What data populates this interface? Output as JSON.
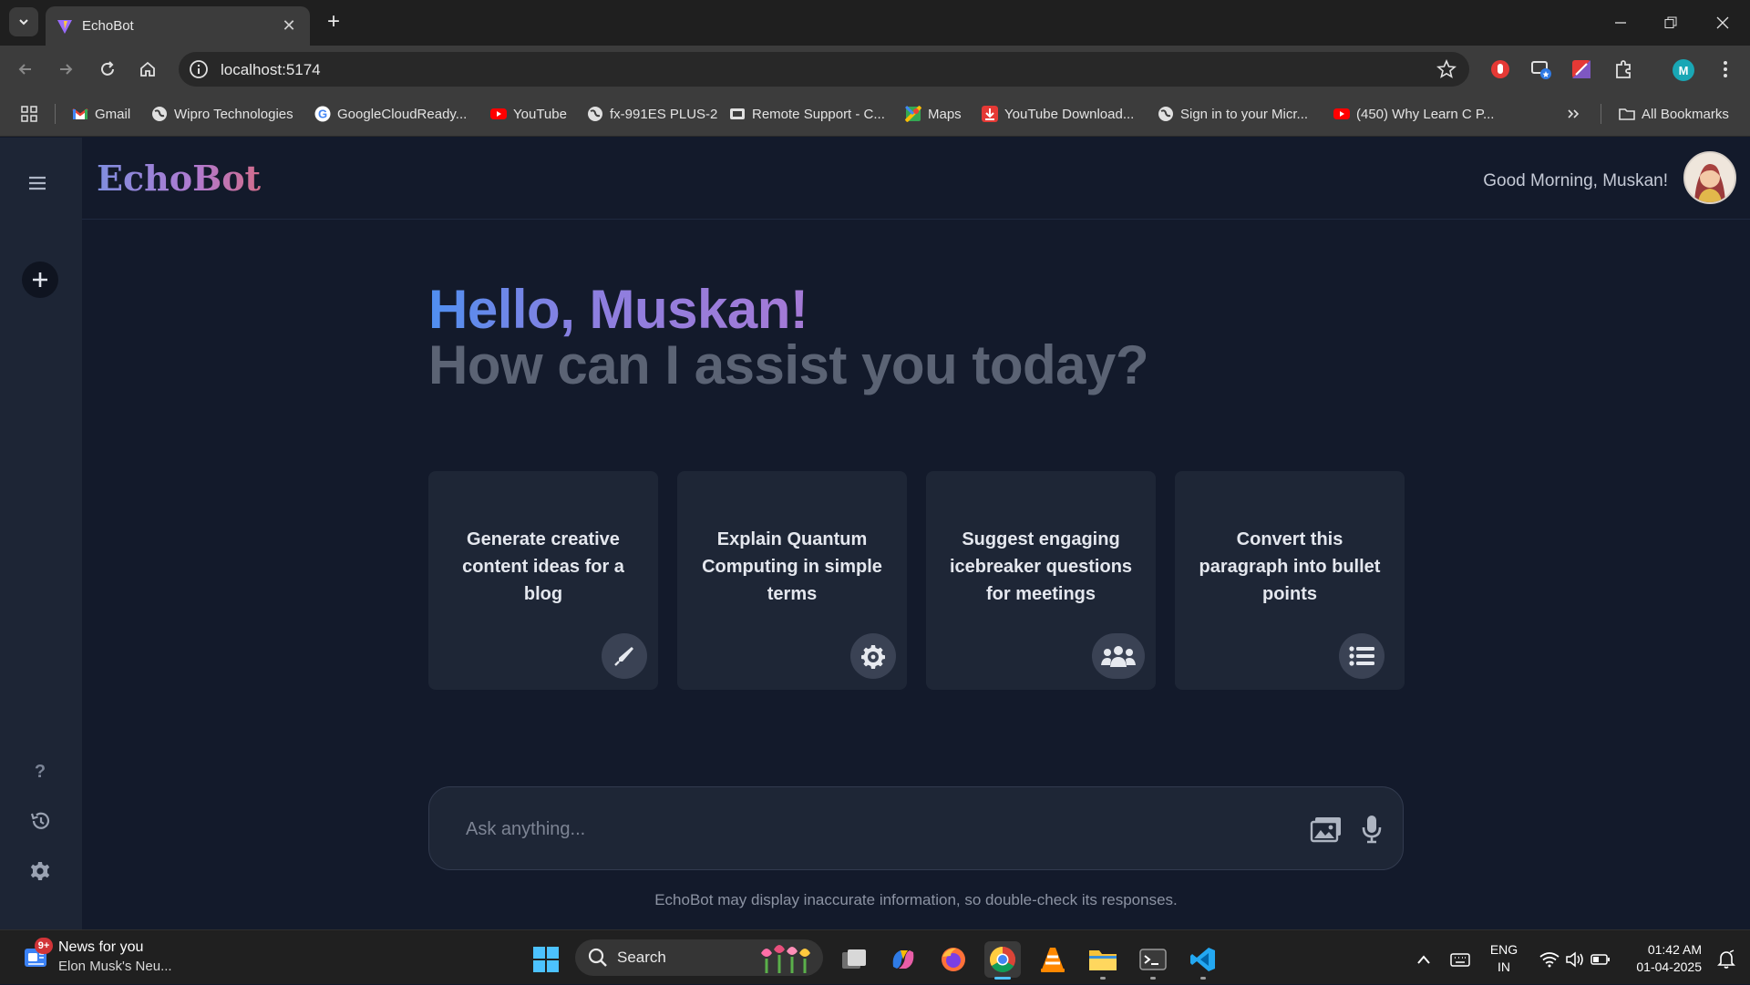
{
  "browser": {
    "tab_title": "EchoBot",
    "url": "localhost:5174",
    "profile_initial": "M",
    "bookmarks": [
      {
        "label": "Gmail",
        "icon": "gmail-icon"
      },
      {
        "label": "Wipro Technologies",
        "icon": "globe-icon"
      },
      {
        "label": "GoogleCloudReady...",
        "icon": "google-icon"
      },
      {
        "label": "YouTube",
        "icon": "youtube-icon"
      },
      {
        "label": "fx-991ES PLUS-2",
        "icon": "globe-icon"
      },
      {
        "label": "Remote Support - C...",
        "icon": "remote-support-icon"
      },
      {
        "label": "Maps",
        "icon": "maps-icon"
      },
      {
        "label": "YouTube Download...",
        "icon": "download-icon"
      },
      {
        "label": "Sign in to your Micr...",
        "icon": "globe-icon"
      },
      {
        "label": "(450) Why Learn C P...",
        "icon": "youtube-icon"
      }
    ],
    "all_bookmarks_label": "All Bookmarks"
  },
  "app": {
    "logo": "EchoBot",
    "greeting": "Good Morning, Muskan!",
    "hello": "Hello, Muskan!",
    "subtitle": "How can I assist you today?",
    "cards": [
      {
        "text": "Generate creative content ideas for a blog",
        "icon": "pen-icon"
      },
      {
        "text": "Explain Quantum Computing in simple terms",
        "icon": "atom-gear-icon"
      },
      {
        "text": "Suggest engaging icebreaker questions for meetings",
        "icon": "users-icon"
      },
      {
        "text": "Convert this paragraph into bullet points",
        "icon": "list-icon"
      }
    ],
    "prompt_placeholder": "Ask anything...",
    "disclaimer": "EchoBot may display inaccurate information, so double-check its responses."
  },
  "taskbar": {
    "news_badge": "9+",
    "news_title": "News for you",
    "news_subtitle": "Elon Musk's Neu...",
    "search_label": "Search",
    "lang_top": "ENG",
    "lang_bottom": "IN",
    "time": "01:42 AM",
    "date": "01-04-2025"
  },
  "colors": {
    "page_bg": "#131a2b",
    "sidebar_bg": "#1d2535",
    "card_bg": "#1e2636",
    "hello_gradient_start": "#4f8ff0",
    "hello_gradient_end": "#a57ad6",
    "subtitle": "#5b6374"
  }
}
